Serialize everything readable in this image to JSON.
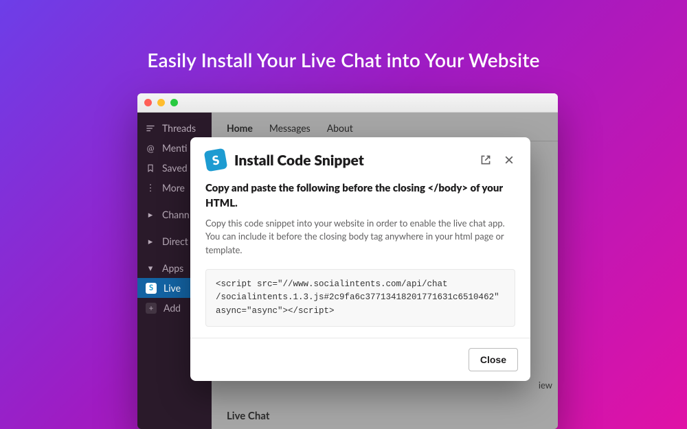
{
  "page": {
    "title": "Easily Install Your Live Chat into Your Website"
  },
  "sidebar": {
    "threads": "Threads",
    "mentions": "Menti",
    "saved": "Saved",
    "more": "More",
    "channels": "Chann",
    "direct": "Direct",
    "apps_header": "Apps",
    "live": "Live",
    "add": "Add"
  },
  "tabs": {
    "home": "Home",
    "messages": "Messages",
    "about": "About"
  },
  "main": {
    "live_chat_label": "Live Chat",
    "view_hint": "iew"
  },
  "modal": {
    "title": "Install Code Snippet",
    "heading": "Copy and paste the following before the closing </body> of your HTML.",
    "description": "Copy this code snippet into your website in order to enable the live chat app.  You can include it before the closing body tag anywhere in your html page or template.",
    "code": "<script src=\"//www.socialintents.com/api/chat\n/socialintents.1.3.js#2c9fa6c37713418201771631c6510462\"\nasync=\"async\"></script>",
    "close_label": "Close",
    "logo_letter": "S"
  }
}
